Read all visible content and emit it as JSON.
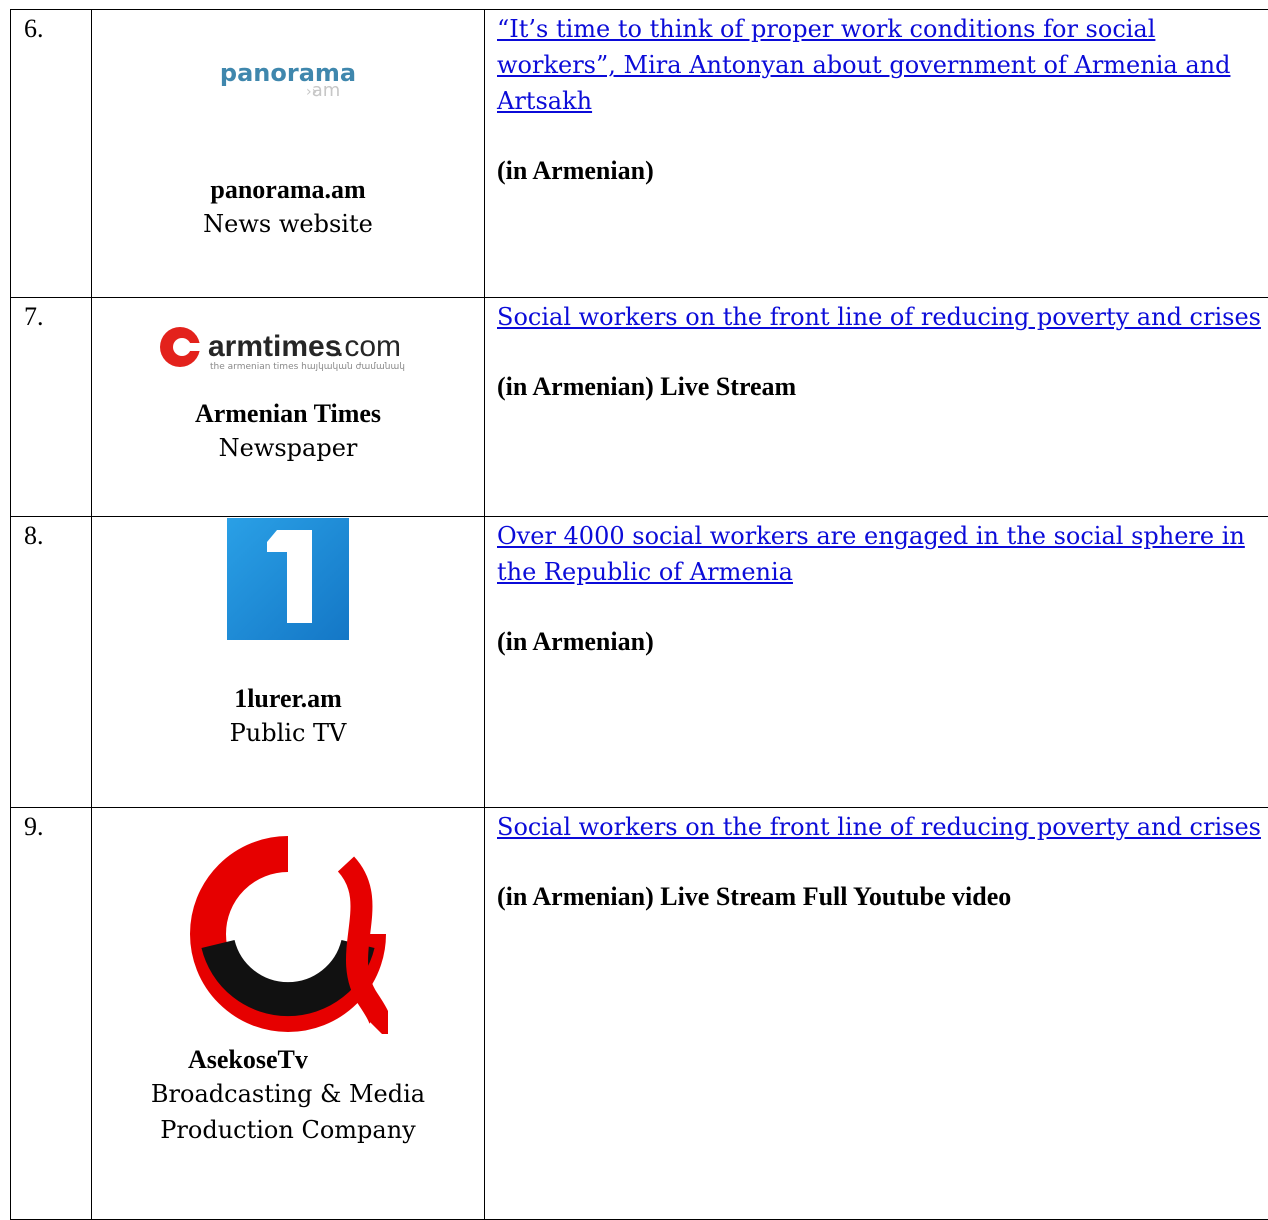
{
  "rows": [
    {
      "number": "6.",
      "logo": {
        "icon": "panorama-logo",
        "text": "panorama",
        "sub": "am"
      },
      "outlet_name": "panorama.am",
      "outlet_type": "News website",
      "headline": "“It’s time to think of proper work conditions for social workers”, Mira Antonyan about government of Armenia and Artsakh",
      "note": "(in Armenian)"
    },
    {
      "number": "7.",
      "logo": {
        "icon": "armtimes-logo",
        "text_bold": "armtimes",
        "text_light": ".com",
        "tagline": "the armenian times   հայկական ժամանակ"
      },
      "outlet_name": "Armenian Times",
      "outlet_type": "Newspaper",
      "headline": "Social workers on the front line of reducing poverty and crises",
      "note": "(in Armenian) Live Stream"
    },
    {
      "number": "8.",
      "logo": {
        "icon": "1lurer-logo",
        "text": "1"
      },
      "outlet_name": "1lurer.am",
      "outlet_type": "Public TV",
      "headline": "Over 4000 social workers are engaged in the social sphere in the Republic of Armenia",
      "note": "(in Armenian)"
    },
    {
      "number": "9.",
      "logo": {
        "icon": "asekosetv-logo"
      },
      "outlet_name": "AsekoseTv",
      "outlet_type": "Broadcasting & Media Production Company",
      "headline": "Social workers on the front line of reducing poverty and crises",
      "note": "(in Armenian) Live Stream Full Youtube video"
    }
  ],
  "colors": {
    "link": "#0b0bd8",
    "panorama": "#3f87ad",
    "armtimes_red": "#e3221c",
    "lurer_blue": "#1f8fd6",
    "asekose_red": "#e60000"
  }
}
